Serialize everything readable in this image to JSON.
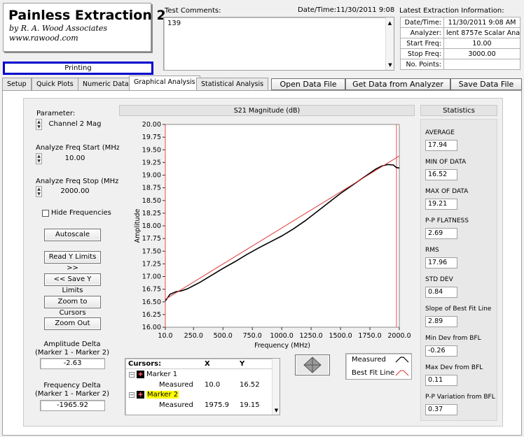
{
  "app": {
    "title": "Painless Extraction 2",
    "byline": "by R. A. Wood Associates",
    "url": "www.rawood.com",
    "status": "Printing"
  },
  "comments": {
    "label": "Test Comments:",
    "text": "139",
    "datetime_label": "Date/Time:",
    "datetime_value": "11/30/2011  9:08"
  },
  "latest": {
    "title": "Latest Extraction Information:",
    "rows": [
      {
        "label": "Date/Time:",
        "value": "11/30/2011  9:08 AM"
      },
      {
        "label": "Analyzer:",
        "value": "lent 8757e Scalar Analyz"
      },
      {
        "label": "Start Freq:",
        "value": "10.00"
      },
      {
        "label": "Stop Freq:",
        "value": "3000.00"
      },
      {
        "label": "No. Points:",
        "value": ""
      }
    ]
  },
  "tabs": [
    "Setup",
    "Quick Plots",
    "Numeric Data",
    "Graphical Analysis",
    "Statistical Analysis"
  ],
  "actions": {
    "open": "Open Data File",
    "get": "Get Data from Analyzer",
    "save": "Save Data File"
  },
  "left": {
    "parameter_label": "Parameter:",
    "parameter_value": "Channel 2 Mag",
    "start_label": "Analyze Freq Start (MHz)",
    "start_value": "10.00",
    "stop_label": "Analyze Freq Stop (MHz)",
    "stop_value": "2000.00",
    "hide_freq": "Hide Frequencies",
    "autoscale": "Autoscale",
    "read_y": "Read Y Limits >>",
    "save_y": "<< Save Y Limits",
    "zoom_cursors": "Zoom to Cursors",
    "zoom_out": "Zoom Out",
    "amp_delta_label1": "Amplitude Delta",
    "amp_delta_label2": "(Marker 1 - Marker 2)",
    "amp_delta_value": "-2.63",
    "freq_delta_label1": "Frequency Delta",
    "freq_delta_label2": "(Marker 1 - Marker 2)",
    "freq_delta_value": "-1965.92"
  },
  "cursors": {
    "headers": [
      "Cursors:",
      "X",
      "Y"
    ],
    "marker1": "Marker 1",
    "marker2": "Marker 2",
    "measured": "Measured",
    "m1_x": "10.0",
    "m1_y": "16.52",
    "m2_x": "1975.9",
    "m2_y": "19.15"
  },
  "legend": {
    "measured": "Measured",
    "bestfit": "Best Fit Line",
    "measured_color": "#000000",
    "bestfit_color": "#e03030"
  },
  "stats": {
    "title": "Statistics",
    "items": [
      {
        "label": "AVERAGE",
        "value": "17.94"
      },
      {
        "label": "MIN OF DATA",
        "value": "16.52"
      },
      {
        "label": "MAX OF DATA",
        "value": "19.21"
      },
      {
        "label": "P-P FLATNESS",
        "value": "2.69"
      },
      {
        "label": "RMS",
        "value": "17.96"
      },
      {
        "label": "STD DEV",
        "value": "0.84"
      },
      {
        "label": "Slope of Best Fit Line",
        "value": "2.89"
      },
      {
        "label": "Min Dev from BFL",
        "value": "-0.26"
      },
      {
        "label": "Max Dev from BFL",
        "value": "0.11"
      },
      {
        "label": "P-P Variation from BFL",
        "value": "0.37"
      }
    ]
  },
  "chart_data": {
    "type": "line",
    "title": "S21 Magnitude (dB)",
    "xlabel": "Frequency (MHz)",
    "ylabel": "Amplitude",
    "xlim": [
      10,
      2000
    ],
    "ylim": [
      16.0,
      20.0
    ],
    "xticks": [
      "10.0",
      "250.0",
      "500.0",
      "750.0",
      "1000.0",
      "1250.0",
      "1500.0",
      "1750.0",
      "2000.0"
    ],
    "yticks": [
      "16.00",
      "16.25",
      "16.50",
      "16.75",
      "17.00",
      "17.25",
      "17.50",
      "17.75",
      "18.00",
      "18.25",
      "18.50",
      "18.75",
      "19.00",
      "19.25",
      "19.50",
      "19.75",
      "20.00"
    ],
    "cursor_x": [
      10.0,
      1975.9
    ],
    "series": [
      {
        "name": "Measured",
        "color": "#000000",
        "x": [
          10,
          50,
          100,
          150,
          200,
          250,
          300,
          400,
          500,
          600,
          700,
          800,
          900,
          1000,
          1100,
          1200,
          1300,
          1400,
          1500,
          1600,
          1700,
          1800,
          1850,
          1900,
          1950,
          1975,
          2000
        ],
        "y": [
          16.52,
          16.65,
          16.7,
          16.72,
          16.76,
          16.82,
          16.88,
          17.02,
          17.16,
          17.29,
          17.43,
          17.56,
          17.68,
          17.8,
          17.94,
          18.1,
          18.28,
          18.46,
          18.64,
          18.8,
          18.96,
          19.12,
          19.18,
          19.21,
          19.2,
          19.15,
          19.14
        ]
      },
      {
        "name": "Best Fit Line",
        "color": "#e03030",
        "x": [
          10,
          2000
        ],
        "y": [
          16.55,
          19.38
        ]
      }
    ]
  }
}
